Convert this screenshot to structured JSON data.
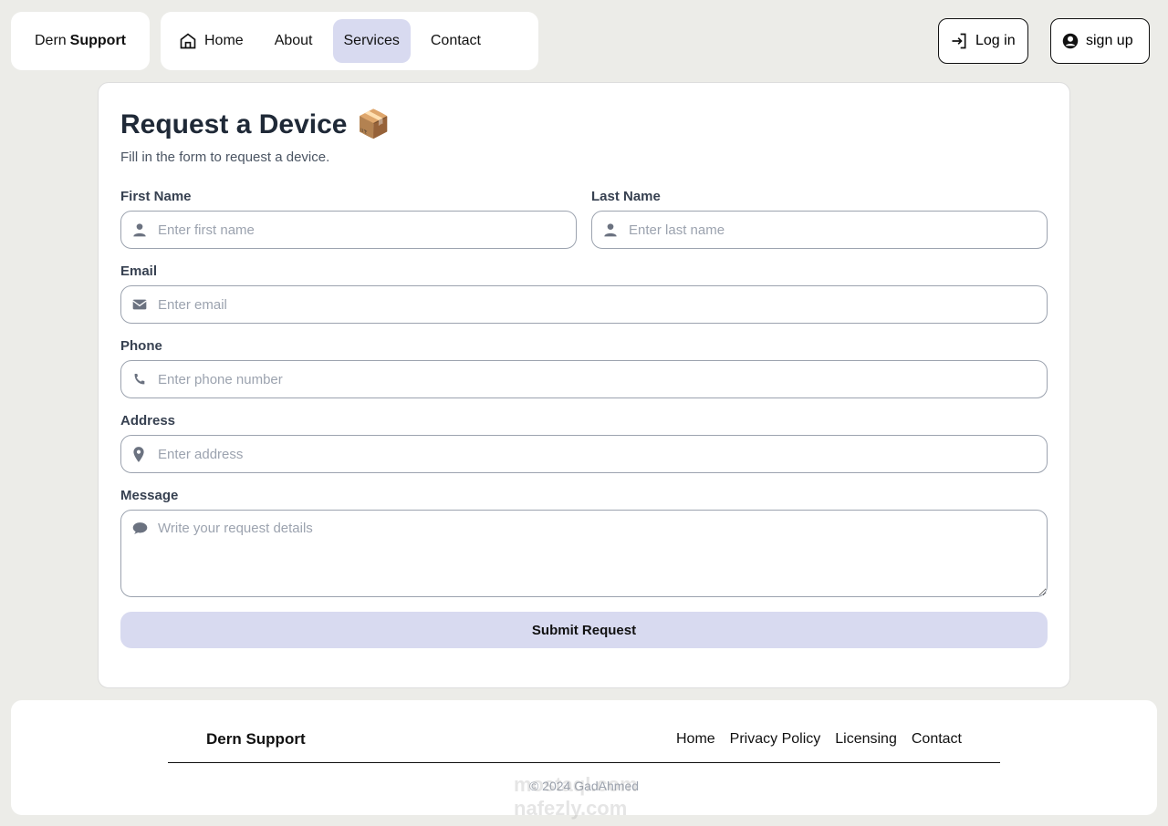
{
  "header": {
    "brand_first": "Dern",
    "brand_bold": "Support",
    "nav": [
      {
        "label": "Home",
        "icon": "home-icon"
      },
      {
        "label": "About"
      },
      {
        "label": "Services",
        "active": true
      },
      {
        "label": "Contact"
      }
    ],
    "login": "Log in",
    "signup": "sign up"
  },
  "form": {
    "title": "Request a Device",
    "emoji": "📦",
    "subtitle": "Fill in the form to request a device.",
    "first_name": {
      "label": "First Name",
      "placeholder": "Enter first name"
    },
    "last_name": {
      "label": "Last Name",
      "placeholder": "Enter last name"
    },
    "email": {
      "label": "Email",
      "placeholder": "Enter email"
    },
    "phone": {
      "label": "Phone",
      "placeholder": "Enter phone number"
    },
    "address": {
      "label": "Address",
      "placeholder": "Enter address"
    },
    "message": {
      "label": "Message",
      "placeholder": "Write your request details"
    },
    "submit": "Submit Request"
  },
  "footer": {
    "brand": "Dern Support",
    "links": [
      "Home",
      "Privacy Policy",
      "Licensing",
      "Contact"
    ],
    "copyright": "© 2024 GadAhmed"
  },
  "watermark": [
    "mostaql.com",
    "nafezly.com"
  ],
  "colors": {
    "accent": "#d8daf0",
    "background": "#ecece8"
  }
}
